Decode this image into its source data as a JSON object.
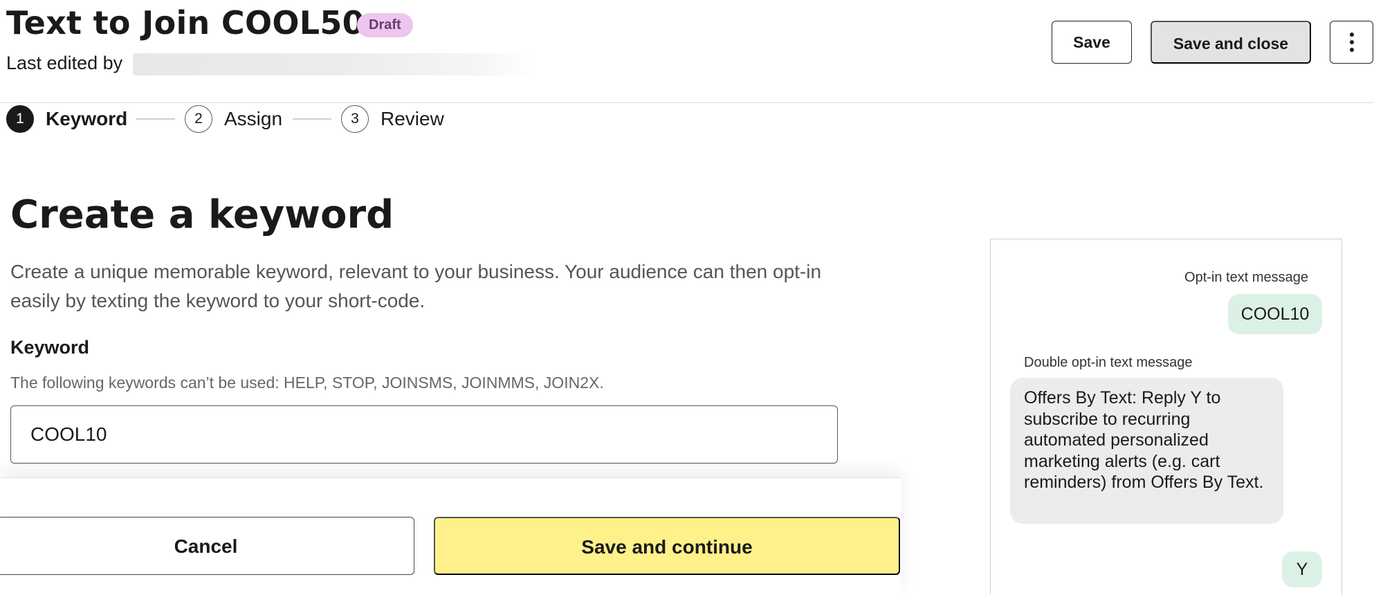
{
  "header": {
    "title": "Text to Join COOL50",
    "status_badge": "Draft",
    "last_edited_label": "Last edited by",
    "save_label": "Save",
    "save_and_close_label": "Save and close",
    "more_icon": "more-vertical-icon"
  },
  "stepper": {
    "steps": [
      {
        "number": "1",
        "label": "Keyword",
        "active": true
      },
      {
        "number": "2",
        "label": "Assign",
        "active": false
      },
      {
        "number": "3",
        "label": "Review",
        "active": false
      }
    ]
  },
  "main": {
    "heading": "Create a keyword",
    "description": "Create a unique memorable keyword, relevant to your business. Your audience can then opt-in easily by texting the keyword to your short-code.",
    "keyword_label": "Keyword",
    "keyword_hint": "The following keywords can’t be used: HELP, STOP, JOINSMS, JOINMMS, JOIN2X.",
    "keyword_value": "COOL10"
  },
  "footer": {
    "cancel_label": "Cancel",
    "continue_label": "Save and continue"
  },
  "preview": {
    "optin_label": "Opt-in text message",
    "optin_message": "COOL10",
    "double_optin_label": "Double opt-in text message",
    "double_optin_message": "Offers By Text: Reply Y to subscribe to recurring automated personalized marketing alerts (e.g. cart reminders) from Offers By Text.",
    "reply_message": "Y"
  },
  "colors": {
    "badge_background": "#ecc6ee",
    "primary_button": "#fff18a",
    "outgoing_bubble": "#dcf1e6",
    "incoming_bubble": "#ececec"
  }
}
